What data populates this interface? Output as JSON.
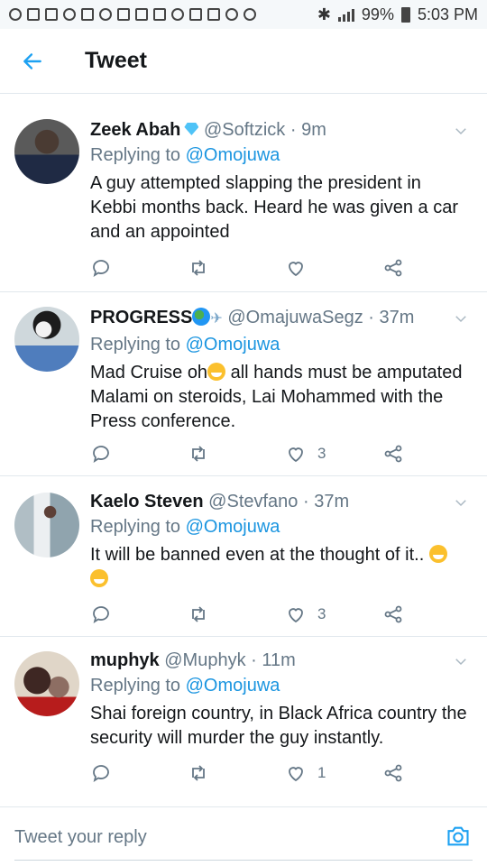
{
  "status_bar": {
    "battery": "99%",
    "time": "5:03 PM"
  },
  "header": {
    "title": "Tweet"
  },
  "tweets": [
    {
      "name": "Zeek Abah",
      "handle": "@Softzick",
      "time": "· 9m",
      "reply_prefix": "Replying to",
      "reply_to": "@Omojuwa",
      "text": "A guy attempted slapping the president in Kebbi months back. Heard he was given a car and an appointed",
      "likes": ""
    },
    {
      "name": "PROGRESS",
      "handle": "@OmajuwaSegz",
      "time": "· 37m",
      "reply_prefix": "Replying to",
      "reply_to": "@Omojuwa",
      "text_a": "Mad Cruise oh",
      "text_b": " all hands must be amputated Malami on steroids, Lai Mohammed with the Press conference.",
      "likes": "3"
    },
    {
      "name": "Kaelo Steven",
      "handle": "@Stevfano",
      "time": "· 37m",
      "reply_prefix": "Replying to",
      "reply_to": "@Omojuwa",
      "text": "It will be banned even at the thought of it.. ",
      "likes": "3"
    },
    {
      "name": "muphyk",
      "handle": "@Muphyk",
      "time": "· 11m",
      "reply_prefix": "Replying to",
      "reply_to": "@Omojuwa",
      "text": "Shai foreign country, in Black Africa country the security will murder the guy instantly.",
      "likes": "1"
    }
  ],
  "composer": {
    "placeholder": "Tweet your reply"
  },
  "colors": {
    "accent": "#1da1f2",
    "mention": "#1b95e0",
    "muted": "#657786",
    "divider": "#e1e8ed"
  }
}
